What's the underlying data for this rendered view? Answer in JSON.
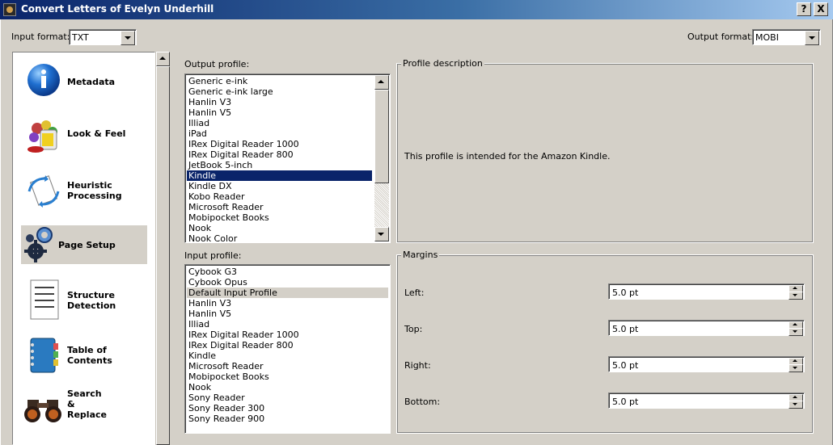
{
  "window": {
    "title": "Convert Letters of Evelyn Underhill",
    "help_label": "?",
    "close_label": "X"
  },
  "formats": {
    "input_label": "Input format:",
    "input_value": "TXT",
    "output_label": "Output format:",
    "output_value": "MOBI"
  },
  "sidebar": {
    "items": [
      {
        "label": "Metadata",
        "icon": "info-icon"
      },
      {
        "label": "Look & Feel",
        "icon": "paint-icon"
      },
      {
        "label": "Heuristic\nProcessing",
        "icon": "heuristic-icon"
      },
      {
        "label": "Page Setup",
        "icon": "gears-icon",
        "selected": true
      },
      {
        "label": "Structure\nDetection",
        "icon": "document-icon"
      },
      {
        "label": "Table of\nContents",
        "icon": "notebook-icon"
      },
      {
        "label": "Search\n&\nReplace",
        "icon": "binoculars-icon"
      }
    ]
  },
  "output_profile": {
    "label": "Output profile:",
    "items": [
      "Generic e-ink",
      "Generic e-ink large",
      "Hanlin V3",
      "Hanlin V5",
      "Illiad",
      "iPad",
      "IRex Digital Reader 1000",
      "IRex Digital Reader 800",
      "JetBook 5-inch",
      "Kindle",
      "Kindle DX",
      "Kobo Reader",
      "Microsoft Reader",
      "Mobipocket Books",
      "Nook",
      "Nook Color"
    ],
    "selected": "Kindle"
  },
  "profile_description": {
    "title": "Profile description",
    "text": "This profile is intended for the Amazon Kindle."
  },
  "input_profile": {
    "label": "Input profile:",
    "items": [
      "Cybook G3",
      "Cybook Opus",
      "Default Input Profile",
      "Hanlin V3",
      "Hanlin V5",
      "Illiad",
      "IRex Digital Reader 1000",
      "IRex Digital Reader 800",
      "Kindle",
      "Microsoft Reader",
      "Mobipocket Books",
      "Nook",
      "Sony Reader",
      "Sony Reader 300",
      "Sony Reader 900"
    ],
    "selected": "Default Input Profile"
  },
  "margins": {
    "title": "Margins",
    "fields": [
      {
        "label": "Left:",
        "value": "5.0 pt"
      },
      {
        "label": "Top:",
        "value": "5.0 pt"
      },
      {
        "label": "Right:",
        "value": "5.0 pt"
      },
      {
        "label": "Bottom:",
        "value": "5.0 pt"
      }
    ]
  }
}
